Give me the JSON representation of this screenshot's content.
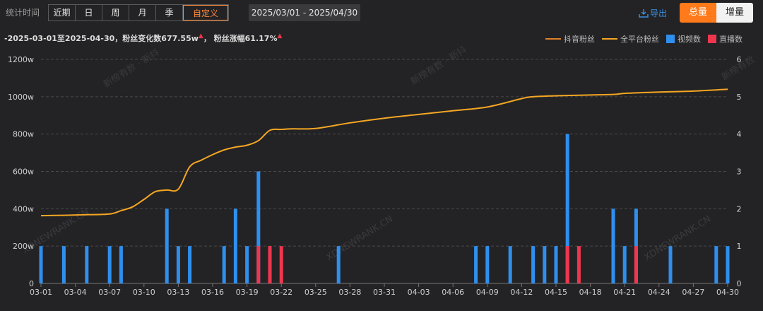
{
  "toolbar": {
    "stat_label": "统计时间",
    "periods": [
      "近期",
      "日",
      "周",
      "月",
      "季",
      "自定义"
    ],
    "active_period": "自定义",
    "date_range": "2025/03/01  -  2025/04/30",
    "export_label": "导出",
    "toggle": [
      "总量",
      "增量"
    ]
  },
  "summary": {
    "text1": "-2025-03-01至2025-04-30，粉丝变化数677.55w",
    "text2": "，  粉丝涨幅61.17%"
  },
  "watermarks": [
    "新榜有数 · 新抖",
    "新榜有数 · 新抖",
    "新榜有数",
    "XDNEWRANK.CN",
    "XDNEWRANK.CN",
    "XDNEWRANK.CN"
  ],
  "colors": {
    "line": "#f5a623",
    "video": "#2f8fef",
    "live": "#f0364f",
    "accent": "#ff7a1a"
  },
  "chart_data": {
    "type": "bar",
    "legend": [
      "抖音粉丝",
      "全平台粉丝",
      "视频数",
      "直播数"
    ],
    "legend_position": "top-right",
    "x_tick_labels": [
      "03-01",
      "03-04",
      "03-07",
      "03-10",
      "03-13",
      "03-16",
      "03-19",
      "03-22",
      "03-25",
      "03-28",
      "03-31",
      "04-03",
      "04-06",
      "04-09",
      "04-12",
      "04-15",
      "04-18",
      "04-21",
      "04-24",
      "04-27",
      "04-30"
    ],
    "y_left": {
      "range": [
        0,
        1200
      ],
      "ticks": [
        "0",
        "200w",
        "400w",
        "600w",
        "800w",
        "1000w",
        "1200w"
      ]
    },
    "y_right": {
      "range": [
        0,
        6
      ],
      "ticks": [
        "0",
        "1",
        "2",
        "3",
        "4",
        "5",
        "6"
      ]
    },
    "grid": true,
    "fans_w": [
      [
        "03-01",
        363
      ],
      [
        "03-03",
        365
      ],
      [
        "03-05",
        368
      ],
      [
        "03-07",
        372
      ],
      [
        "03-08",
        390
      ],
      [
        "03-09",
        410
      ],
      [
        "03-10",
        450
      ],
      [
        "03-11",
        492
      ],
      [
        "03-12",
        500
      ],
      [
        "03-13",
        505
      ],
      [
        "03-14",
        625
      ],
      [
        "03-15",
        660
      ],
      [
        "03-16",
        690
      ],
      [
        "03-17",
        715
      ],
      [
        "03-18",
        730
      ],
      [
        "03-19",
        740
      ],
      [
        "03-20",
        765
      ],
      [
        "03-21",
        820
      ],
      [
        "03-22",
        825
      ],
      [
        "03-23",
        828
      ],
      [
        "03-25",
        830
      ],
      [
        "03-28",
        860
      ],
      [
        "03-31",
        885
      ],
      [
        "04-03",
        905
      ],
      [
        "04-06",
        925
      ],
      [
        "04-09",
        945
      ],
      [
        "04-12",
        990
      ],
      [
        "04-13",
        1000
      ],
      [
        "04-15",
        1005
      ],
      [
        "04-17",
        1008
      ],
      [
        "04-20",
        1012
      ],
      [
        "04-21",
        1018
      ],
      [
        "04-24",
        1025
      ],
      [
        "04-27",
        1030
      ],
      [
        "04-30",
        1040
      ]
    ],
    "videos": [
      [
        "03-01",
        1
      ],
      [
        "03-03",
        1
      ],
      [
        "03-05",
        1
      ],
      [
        "03-07",
        1
      ],
      [
        "03-08",
        1
      ],
      [
        "03-12",
        2
      ],
      [
        "03-13",
        1
      ],
      [
        "03-14",
        1
      ],
      [
        "03-17",
        1
      ],
      [
        "03-18",
        2
      ],
      [
        "03-19",
        1
      ],
      [
        "03-20",
        3
      ],
      [
        "03-27",
        1
      ],
      [
        "04-08",
        1
      ],
      [
        "04-09",
        1
      ],
      [
        "04-11",
        1
      ],
      [
        "04-13",
        1
      ],
      [
        "04-14",
        1
      ],
      [
        "04-15",
        1
      ],
      [
        "04-16",
        4
      ],
      [
        "04-20",
        2
      ],
      [
        "04-21",
        1
      ],
      [
        "04-22",
        2
      ],
      [
        "04-25",
        1
      ],
      [
        "04-29",
        1
      ],
      [
        "04-30",
        1
      ]
    ],
    "lives": [
      [
        "03-20",
        1
      ],
      [
        "03-21",
        1
      ],
      [
        "03-22",
        1
      ],
      [
        "04-16",
        1
      ],
      [
        "04-17",
        1
      ],
      [
        "04-22",
        1
      ]
    ]
  }
}
